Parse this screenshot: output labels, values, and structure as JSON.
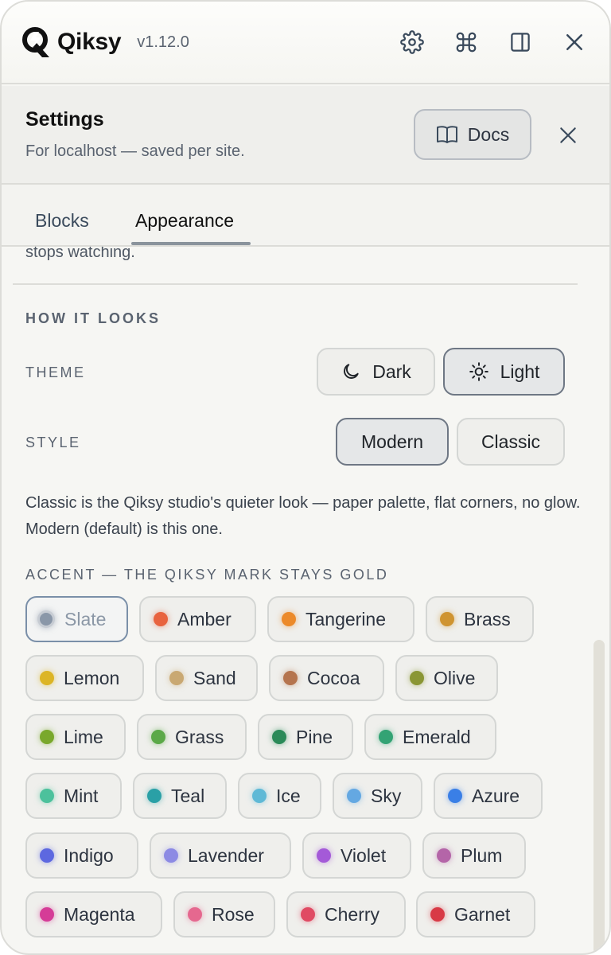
{
  "header": {
    "app_name": "Qiksy",
    "version": "v1.12.0",
    "icons": [
      "gear-icon",
      "command-icon",
      "sidebar-panel-icon",
      "close-icon"
    ]
  },
  "settings": {
    "title": "Settings",
    "subtitle": "For localhost — saved per site.",
    "docs_label": "Docs"
  },
  "tabs": [
    {
      "label": "Blocks",
      "active": false
    },
    {
      "label": "Appearance",
      "active": true
    }
  ],
  "content": {
    "previous_text_fragment": "stops watching.",
    "section_title": "HOW IT LOOKS",
    "theme": {
      "label": "THEME",
      "options": [
        {
          "label": "Dark",
          "icon": "moon-icon",
          "active": false
        },
        {
          "label": "Light",
          "icon": "sun-icon",
          "active": true
        }
      ]
    },
    "style": {
      "label": "STYLE",
      "options": [
        {
          "label": "Modern",
          "active": true
        },
        {
          "label": "Classic",
          "active": false
        }
      ]
    },
    "description": "Classic is the Qiksy studio's quieter look — paper palette, flat corners, no glow. Modern (default) is this one.",
    "accent": {
      "label": "ACCENT — THE QIKSY MARK STAYS GOLD",
      "selected": "Slate",
      "options": [
        {
          "label": "Slate",
          "color": "#8a97a8"
        },
        {
          "label": "Amber",
          "color": "#e8633f"
        },
        {
          "label": "Tangerine",
          "color": "#ec8a2a"
        },
        {
          "label": "Brass",
          "color": "#cf9431"
        },
        {
          "label": "Lemon",
          "color": "#dcb526"
        },
        {
          "label": "Sand",
          "color": "#c9a872"
        },
        {
          "label": "Cocoa",
          "color": "#b5744e"
        },
        {
          "label": "Olive",
          "color": "#8a9634"
        },
        {
          "label": "Lime",
          "color": "#79a82c"
        },
        {
          "label": "Grass",
          "color": "#5ba948"
        },
        {
          "label": "Pine",
          "color": "#2a8a58"
        },
        {
          "label": "Emerald",
          "color": "#33a374"
        },
        {
          "label": "Mint",
          "color": "#4cc19c"
        },
        {
          "label": "Teal",
          "color": "#2aa0a6"
        },
        {
          "label": "Ice",
          "color": "#5fb9d6"
        },
        {
          "label": "Sky",
          "color": "#64a8e2"
        },
        {
          "label": "Azure",
          "color": "#3a7fe6"
        },
        {
          "label": "Indigo",
          "color": "#5d68e0"
        },
        {
          "label": "Lavender",
          "color": "#8c8ae4"
        },
        {
          "label": "Violet",
          "color": "#a45ad8"
        },
        {
          "label": "Plum",
          "color": "#b465a8"
        },
        {
          "label": "Magenta",
          "color": "#d53c97"
        },
        {
          "label": "Rose",
          "color": "#e5688f"
        },
        {
          "label": "Cherry",
          "color": "#e04a63"
        },
        {
          "label": "Garnet",
          "color": "#d83a46"
        }
      ]
    }
  }
}
